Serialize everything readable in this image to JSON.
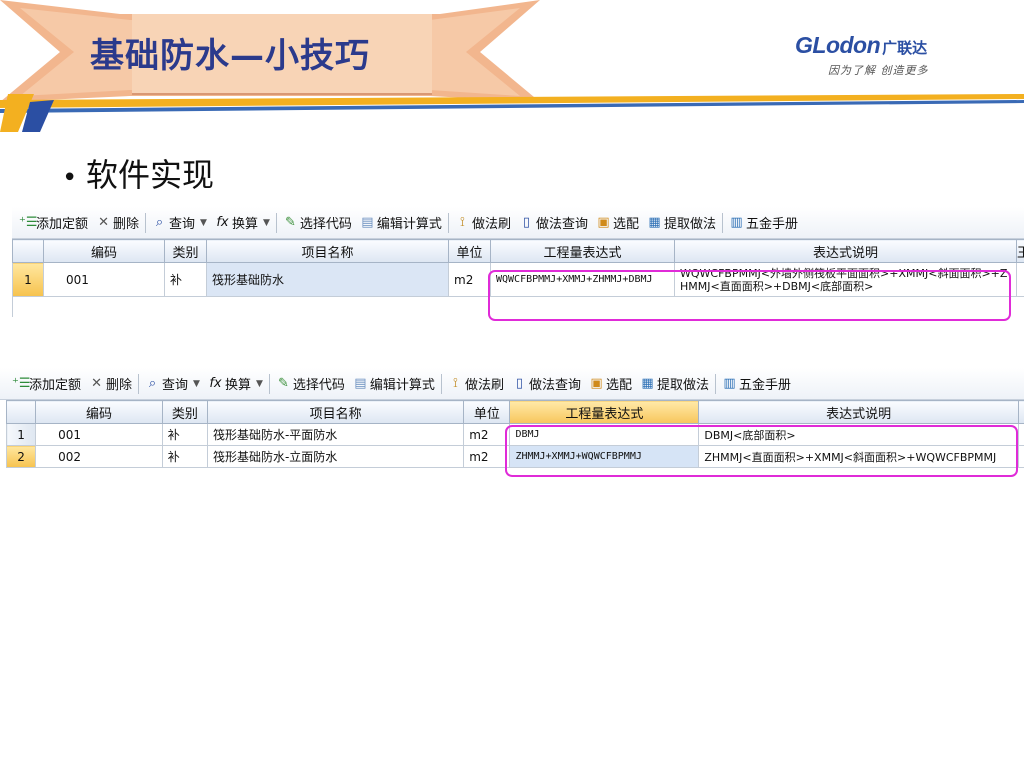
{
  "slide": {
    "title": "基础防水—小技巧",
    "logo_text": "GLodon",
    "logo_cn": "广联达",
    "slogan": "因为了解 创造更多",
    "bullet": "软件实现"
  },
  "toolbar": {
    "add_quota": "添加定额",
    "delete": "删除",
    "query": "查询",
    "convert": "换算",
    "select_code": "选择代码",
    "edit_formula": "编辑计算式",
    "method_brush": "做法刷",
    "method_query": "做法查询",
    "select_match": "选配",
    "extract_method": "提取做法",
    "hardware_manual": "五金手册"
  },
  "columns": {
    "code": "编码",
    "category": "类别",
    "item_name": "项目名称",
    "unit": "单位",
    "quantity_expr": "工程量表达式",
    "expr_desc": "表达式说明"
  },
  "table1": {
    "rows": [
      {
        "row_no": "1",
        "code": "001",
        "category": "补",
        "item_name": "筏形基础防水",
        "unit": "m2",
        "quantity_expr": "WQWCFBPMMJ+XMMJ+ZHMMJ+DBMJ",
        "expr_desc": "WQWCFBPMMJ<外墙外侧筏板平面面积>+XMMJ<斜面面积>+ZHMMJ<直面面积>+DBMJ<底部面积>"
      }
    ]
  },
  "table2": {
    "rows": [
      {
        "row_no": "1",
        "code": "001",
        "category": "补",
        "item_name": "筏形基础防水-平面防水",
        "unit": "m2",
        "quantity_expr": "DBMJ",
        "expr_desc": "DBMJ<底部面积>"
      },
      {
        "row_no": "2",
        "code": "002",
        "category": "补",
        "item_name": "筏形基础防水-立面防水",
        "unit": "m2",
        "quantity_expr": "ZHMMJ+XMMJ+WQWCFBPMMJ",
        "expr_desc": "ZHMMJ<直面面积>+XMMJ<斜面面积>+WQWCFBPMMJ"
      }
    ]
  },
  "colors": {
    "title": "#2b3a8c",
    "banner": "#f2b68e",
    "highlight_box": "#e02bd8",
    "header_selected": "#f7c65c"
  },
  "icons": [
    "add-quota-icon",
    "delete-icon",
    "search-icon",
    "function-icon",
    "select-code-icon",
    "edit-formula-icon",
    "brush-icon",
    "method-query-icon",
    "select-match-icon",
    "extract-method-icon",
    "manual-icon"
  ]
}
